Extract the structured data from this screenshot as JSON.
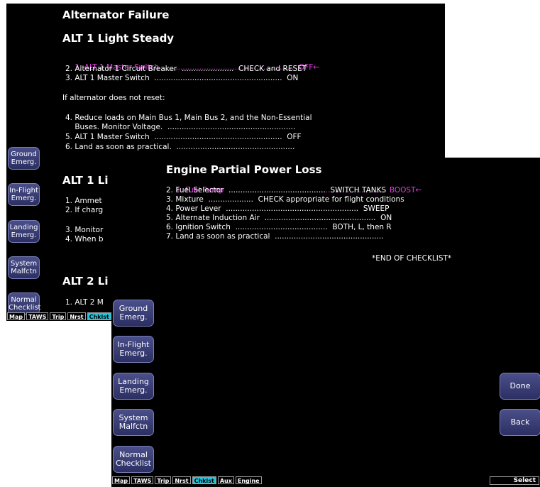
{
  "back": {
    "title": "Alternator Failure",
    "subtitle": "ALT 1 Light Steady",
    "steps": [
      {
        "text": "1. ALT 1 Master Switch  .......................................................  OFF",
        "arrow": "←",
        "highlight": true
      },
      {
        "text": "2. Alternator 1 Circuit Breaker  ......................  CHECK and RESET",
        "arrow": "",
        "highlight": false
      },
      {
        "text": "3. ALT 1 Master Switch  ......................................................  ON",
        "arrow": "",
        "highlight": false
      }
    ],
    "note": "If alternator does not reset:",
    "step4": "4. Reduce loads on Main Bus 1, Main Bus 2, and the Non-Essential",
    "step4b": "    Buses. Monitor Voltage.  ......................................................",
    "step5": "5. ALT 1 Master Switch  ......................................................  OFF",
    "step6": "6. Land as soon as practical.  ..................................................",
    "section2_title": "ALT 1 Li",
    "section2_lines": [
      "1. Ammet",
      "2. If charg",
      "",
      "3. Monitor",
      "4. When b"
    ],
    "section3_title": "ALT 2 Li",
    "section3_line": "1. ALT 2 M",
    "softkeys": [
      {
        "l1": "Ground",
        "l2": "Emerg."
      },
      {
        "l1": "In-Flight",
        "l2": "Emerg."
      },
      {
        "l1": "Landing",
        "l2": "Emerg."
      },
      {
        "l1": "System",
        "l2": "Malfctn"
      },
      {
        "l1": "Normal",
        "l2": "Checklist"
      }
    ],
    "tabs": [
      "Map",
      "TAWS",
      "Trip",
      "Nrst",
      "Chklst"
    ]
  },
  "front": {
    "title": "Engine Partial Power Loss",
    "steps": [
      {
        "text": "1. Fuel Pump  ..................................................................  BOOST",
        "arrow": "←",
        "highlight": true
      },
      {
        "text": "2. Fuel Selector  .........................................  SWITCH TANKS",
        "arrow": "",
        "highlight": false
      },
      {
        "text": "3. Mixture  ...................  CHECK appropriate for flight conditions",
        "arrow": "",
        "highlight": false
      },
      {
        "text": "4. Power Lever  ........................................................  SWEEP",
        "arrow": "",
        "highlight": false
      },
      {
        "text": "5. Alternate Induction Air  ...............................................  ON",
        "arrow": "",
        "highlight": false
      },
      {
        "text": "6. Ignition Switch  .......................................  BOTH, L, then R",
        "arrow": "",
        "highlight": false
      },
      {
        "text": "7. Land as soon as practical  ..............................................",
        "arrow": "",
        "highlight": false
      }
    ],
    "end": "*END OF CHECKLIST*",
    "softkeys": [
      {
        "l1": "Ground",
        "l2": "Emerg."
      },
      {
        "l1": "In-Flight",
        "l2": "Emerg."
      },
      {
        "l1": "Landing",
        "l2": "Emerg."
      },
      {
        "l1": "System",
        "l2": "Malfctn"
      },
      {
        "l1": "Normal",
        "l2": "Checklist"
      }
    ],
    "done_label": "Done",
    "back_label": "Back",
    "tabs": [
      "Map",
      "TAWS",
      "Trip",
      "Nrst",
      "Chklst",
      "Aux",
      "Engine"
    ],
    "select_label": "Select"
  },
  "colors": {
    "highlight": "#e040e0",
    "active_tab": "#22c8e0",
    "softkey": "#3a3f78"
  }
}
